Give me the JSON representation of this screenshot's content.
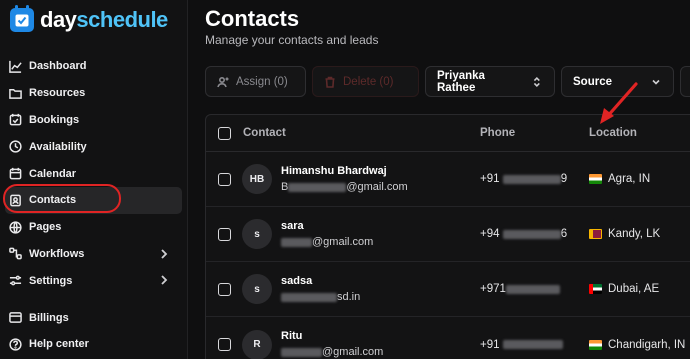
{
  "brand": {
    "name_part1": "day",
    "name_part2": "schedule"
  },
  "sidebar": {
    "items": [
      {
        "label": "Dashboard",
        "icon": "chart-line-icon"
      },
      {
        "label": "Resources",
        "icon": "folder-icon"
      },
      {
        "label": "Bookings",
        "icon": "calendar-check-icon"
      },
      {
        "label": "Availability",
        "icon": "clock-icon"
      },
      {
        "label": "Calendar",
        "icon": "calendar-icon"
      },
      {
        "label": "Contacts",
        "icon": "contact-card-icon",
        "active": true
      },
      {
        "label": "Pages",
        "icon": "globe-icon"
      },
      {
        "label": "Workflows",
        "icon": "workflow-icon",
        "has_children": true
      },
      {
        "label": "Settings",
        "icon": "sliders-icon",
        "has_children": true
      },
      {
        "label": "Billings",
        "icon": "billing-icon"
      },
      {
        "label": "Help center",
        "icon": "help-circle-icon"
      }
    ]
  },
  "header": {
    "title": "Contacts",
    "subtitle": "Manage your contacts and leads"
  },
  "toolbar": {
    "assign_label": "Assign (0)",
    "delete_label": "Delete (0)",
    "owner_select": "Priyanka Rathee",
    "source_select": "Source"
  },
  "table": {
    "columns": {
      "contact": "Contact",
      "phone": "Phone",
      "location": "Location"
    },
    "rows": [
      {
        "initials": "HB",
        "name": "Himanshu Bhardwaj",
        "email_prefix": "B",
        "email_suffix": "@gmail.com",
        "phone_prefix": "+91",
        "phone_suffix": "9",
        "location": "Agra, IN",
        "flag": "in"
      },
      {
        "initials": "s",
        "name": "sara",
        "email_prefix": "",
        "email_suffix": "@gmail.com",
        "phone_prefix": "+94",
        "phone_suffix": "6",
        "location": "Kandy, LK",
        "flag": "lk"
      },
      {
        "initials": "s",
        "name": "sadsa",
        "email_prefix": "",
        "email_suffix": "sd.in",
        "phone_prefix": "+971",
        "phone_suffix": "",
        "location": "Dubai, AE",
        "flag": "ae"
      },
      {
        "initials": "R",
        "name": "Ritu",
        "email_prefix": "",
        "email_suffix": "@gmail.com",
        "phone_prefix": "+91",
        "phone_suffix": "",
        "location": "Chandigarh, IN",
        "flag": "in"
      }
    ]
  },
  "colors": {
    "accent_blue": "#1e88e5",
    "brand_light": "#4fc3f7",
    "annotation_red": "#e02424",
    "background": "#0f0f10"
  }
}
